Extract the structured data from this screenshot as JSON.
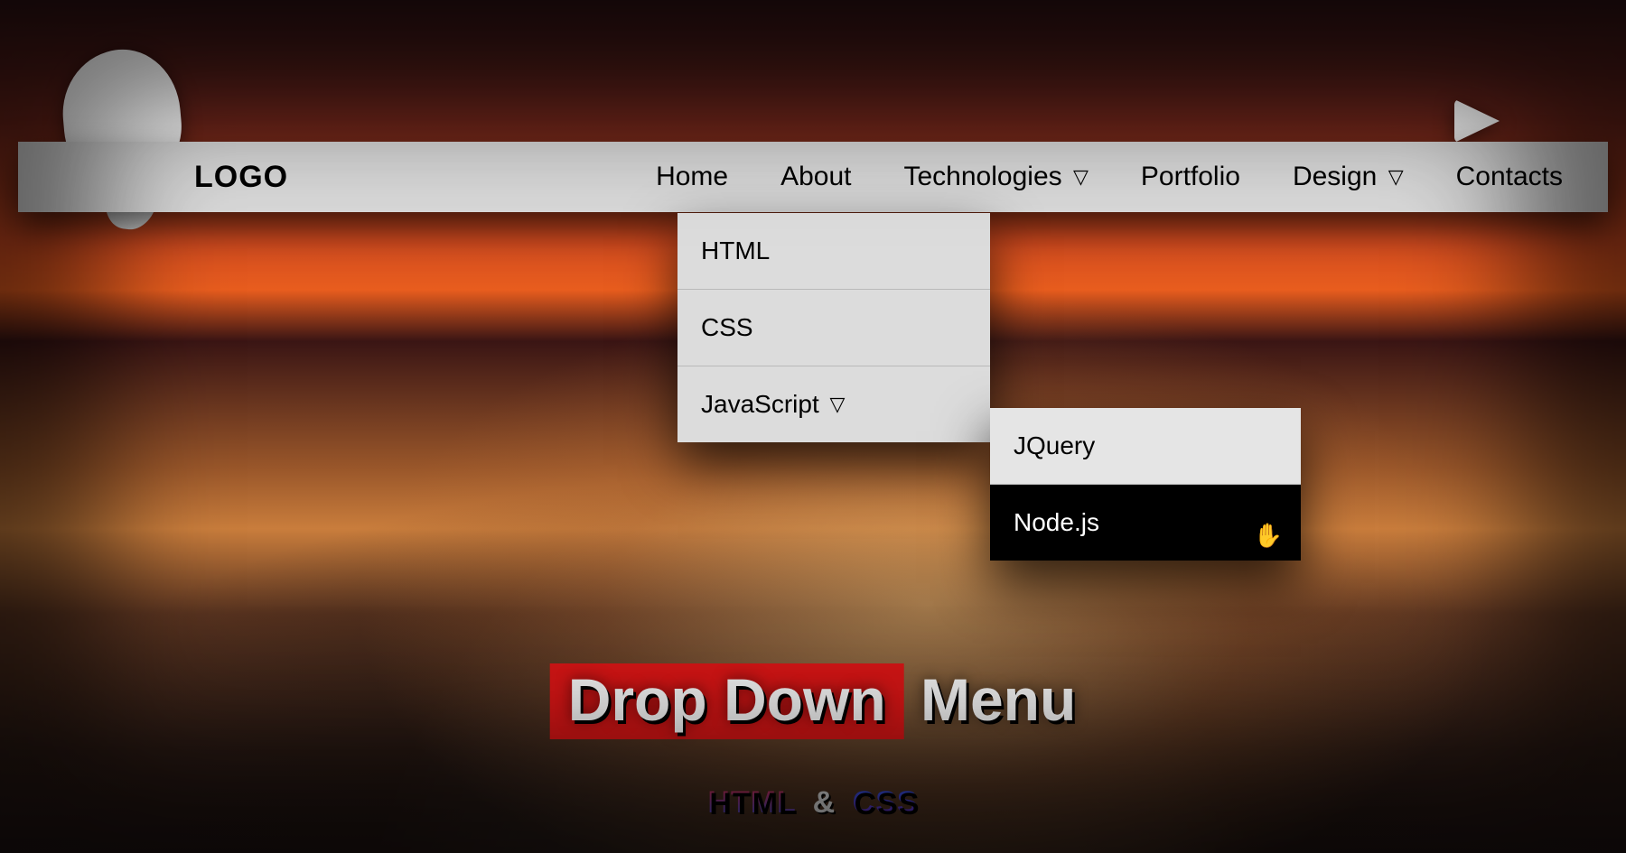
{
  "nav": {
    "logo": "LOGO",
    "items": [
      {
        "label": "Home",
        "hasChildren": false
      },
      {
        "label": "About",
        "hasChildren": false
      },
      {
        "label": "Technologies",
        "hasChildren": true
      },
      {
        "label": "Portfolio",
        "hasChildren": false
      },
      {
        "label": "Design",
        "hasChildren": true
      },
      {
        "label": "Contacts",
        "hasChildren": false
      }
    ]
  },
  "dropdown": {
    "items": [
      {
        "label": "HTML",
        "hasChildren": false
      },
      {
        "label": "CSS",
        "hasChildren": false
      },
      {
        "label": "JavaScript",
        "hasChildren": true
      }
    ]
  },
  "flyout": {
    "items": [
      {
        "label": "JQuery",
        "active": false
      },
      {
        "label": "Node.js",
        "active": true
      }
    ]
  },
  "chevGlyph": "▽",
  "headline": {
    "highlight": "Drop Down",
    "rest": " Menu"
  },
  "subtitle": {
    "a": "HTML",
    "amp": "&",
    "b": "CSS"
  }
}
